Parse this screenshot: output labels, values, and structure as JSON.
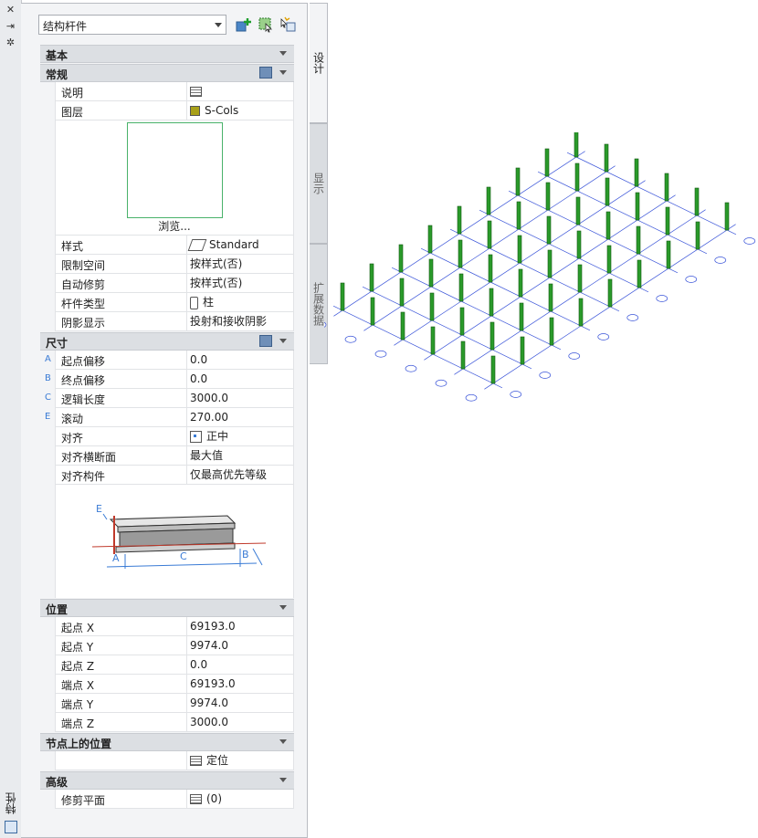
{
  "window": {
    "title": "特性"
  },
  "toolbar": {
    "object_type": "结构杆件"
  },
  "tabs": [
    {
      "label": "设计"
    },
    {
      "label": "显示"
    },
    {
      "label": "扩展数据"
    }
  ],
  "sections": {
    "basic": "基本",
    "general": "常规",
    "dimensions": "尺寸",
    "location": "位置",
    "location_on_node": "节点上的位置",
    "advanced": "高级"
  },
  "general": {
    "description": {
      "name": "说明",
      "value": ""
    },
    "layer": {
      "name": "图层",
      "value": "S-Cols"
    },
    "browse": "浏览...",
    "style": {
      "name": "样式",
      "value": "Standard"
    },
    "bound_spaces": {
      "name": "限制空间",
      "value": "按样式(否)"
    },
    "auto_trim": {
      "name": "自动修剪",
      "value": "按样式(否)"
    },
    "member_type": {
      "name": "杆件类型",
      "value": "柱"
    },
    "shadow": {
      "name": "阴影显示",
      "value": "投射和接收阴影"
    }
  },
  "dimensions": {
    "start_offset": {
      "marker": "A",
      "name": "起点偏移",
      "value": "0.0"
    },
    "end_offset": {
      "marker": "B",
      "name": "终点偏移",
      "value": "0.0"
    },
    "logical_length": {
      "marker": "C",
      "name": "逻辑长度",
      "value": "3000.0"
    },
    "roll": {
      "marker": "E",
      "name": "滚动",
      "value": "270.00"
    },
    "justify": {
      "name": "对齐",
      "value": "正中"
    },
    "justify_section": {
      "name": "对齐横断面",
      "value": "最大值"
    },
    "justify_component": {
      "name": "对齐构件",
      "value": "仅最高优先等级"
    },
    "diagram_labels": {
      "a": "A",
      "b": "B",
      "c": "C",
      "e": "E"
    }
  },
  "location": {
    "start_x": {
      "name": "起点 X",
      "value": "69193.0"
    },
    "start_y": {
      "name": "起点 Y",
      "value": "9974.0"
    },
    "start_z": {
      "name": "起点 Z",
      "value": "0.0"
    },
    "end_x": {
      "name": "端点 X",
      "value": "69193.0"
    },
    "end_y": {
      "name": "端点 Y",
      "value": "9974.0"
    },
    "end_z": {
      "name": "端点 Z",
      "value": "3000.0"
    }
  },
  "node": {
    "locate": "定位"
  },
  "advanced": {
    "trim_planes": {
      "name": "修剪平面",
      "value": "(0)"
    }
  },
  "colors": {
    "column": "#2a9a2a",
    "grid": "#3b55d9",
    "accent": "#3a7bd5"
  }
}
